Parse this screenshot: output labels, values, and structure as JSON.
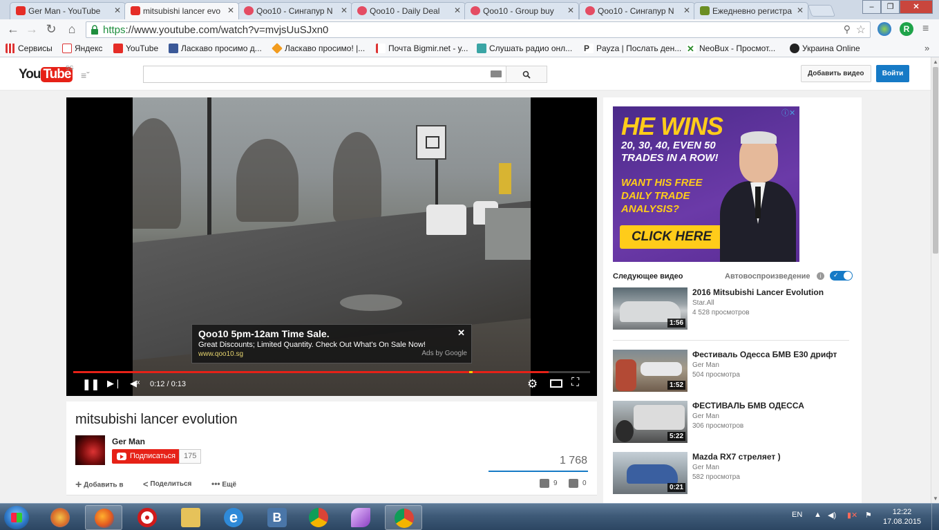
{
  "browser": {
    "tabs": [
      {
        "label": "Ger Man - YouTube",
        "icon": "youtube-favicon",
        "active": false
      },
      {
        "label": "mitsubishi lancer evo",
        "icon": "youtube-favicon",
        "active": true
      },
      {
        "label": "Qoo10 - Сингапур N",
        "icon": "qoo10-favicon",
        "active": false
      },
      {
        "label": "Qoo10 - Daily Deal",
        "icon": "qoo10-favicon",
        "active": false
      },
      {
        "label": "Qoo10 - Group buy",
        "icon": "qoo10-favicon",
        "active": false
      },
      {
        "label": "Qoo10 - Сингапур N",
        "icon": "qoo10-favicon",
        "active": false
      },
      {
        "label": "Ежедневно регистра",
        "icon": "generic-favicon",
        "active": false
      }
    ],
    "url_scheme": "https",
    "url_rest": "://www.youtube.com/watch?v=mvjsUuSJxn0",
    "bookmarks": [
      {
        "label": "Сервисы",
        "icon": "apps-icon"
      },
      {
        "label": "Яндекс",
        "icon": "yandex-icon"
      },
      {
        "label": "YouTube",
        "icon": "youtube-icon"
      },
      {
        "label": "Ласкаво просимо д...",
        "icon": "facebook-icon"
      },
      {
        "label": "Ласкаво просимо! |...",
        "icon": "diamond-icon"
      },
      {
        "label": "Почта Bigmir.net - у...",
        "icon": "bigmir-icon"
      },
      {
        "label": "Слушать радио онл...",
        "icon": "fm-icon"
      },
      {
        "label": "Payza | Послать ден...",
        "icon": "payza-icon"
      },
      {
        "label": "NeoBux - Просмот...",
        "icon": "neobux-icon"
      },
      {
        "label": "Украина Online",
        "icon": "ukraine-online-icon"
      }
    ]
  },
  "youtube": {
    "logo_you": "You",
    "logo_tube": "Tube",
    "region": "SG",
    "upload_label": "Добавить видео",
    "signin_label": "Войти",
    "player": {
      "time": "0:12 / 0:13",
      "progress": 0.92,
      "ad": {
        "title": "Qoo10 5pm-12am Time Sale.",
        "text": "Great Discounts; Limited Quantity. Check Out What's On Sale Now!",
        "url": "www.qoo10.sg",
        "by": "Ads by Google"
      }
    },
    "video": {
      "title": "mitsubishi lancer evolution",
      "channel": "Ger Man",
      "subscribe_label": "Подписаться",
      "subscribers": "175",
      "views": "1 768",
      "add_to": "Добавить в",
      "share": "Поделиться",
      "more": "Ещё",
      "likes": "9",
      "dislikes": "0"
    },
    "sidebar": {
      "ad": {
        "headline": "HE WINS",
        "sub": "20, 30, 40, EVEN 50 TRADES IN A ROW!",
        "want": "WANT HIS FREE DAILY TRADE ANALYSIS?",
        "cta": "CLICK HERE"
      },
      "upnext_label": "Следующее видео",
      "autoplay_label": "Автовоспроизведение",
      "autoplay_on": true,
      "videos": [
        {
          "title": "2016 Mitsubishi Lancer Evolution",
          "author": "Star.All",
          "views": "4 528 просмотров",
          "duration": "1:56"
        },
        {
          "title": "Фестиваль Одесса БМВ Е30 дрифт",
          "author": "Ger Man",
          "views": "504 просмотра",
          "duration": "1:52"
        },
        {
          "title": "ФЕСТИВАЛЬ БМВ ОДЕССА",
          "author": "Ger Man",
          "views": "306 просмотров",
          "duration": "5:22"
        },
        {
          "title": "Mazda RX7 стреляет )",
          "author": "Ger Man",
          "views": "582 просмотра",
          "duration": "0:21"
        }
      ]
    }
  },
  "taskbar": {
    "lang": "EN",
    "time": "12:22",
    "date": "17.08.2015"
  },
  "colors": {
    "youtube_red": "#e62117",
    "youtube_blue": "#167ac6",
    "ad_purple": "#5a2c95",
    "ad_yellow": "#ffcc1a"
  }
}
